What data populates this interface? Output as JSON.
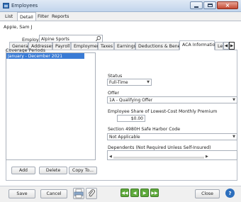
{
  "window": {
    "title": "Employees"
  },
  "menu": {
    "list": "List",
    "detail": "Detail",
    "filter": "Filter",
    "reports": "Reports"
  },
  "person": {
    "name": "Apple, Sam J"
  },
  "tabs": [
    "General",
    "Addresses",
    "Payroll",
    "Employment",
    "Taxes",
    "Earnings",
    "Deductions & Benefits",
    "ACA Information",
    "Le"
  ],
  "employer": {
    "label": "Employer",
    "value": "Alpine Sports"
  },
  "coverage": {
    "label": "Coverage Periods",
    "items": [
      "January - December 2021"
    ]
  },
  "status": {
    "label": "Status",
    "value": "Full-Time"
  },
  "offer": {
    "label": "Offer",
    "value": "1A - Qualifying Offer"
  },
  "premium": {
    "label": "Employee Share of Lowest-Cost Monthly Premium",
    "value": "$0.00"
  },
  "safe_harbor": {
    "label": "Section 4980H Safe Harbor Code",
    "value": "Not Applicable"
  },
  "dependents": {
    "label": "Dependents (Not Required Unless Self-Insured)"
  },
  "list_buttons": {
    "add": "Add",
    "delete": "Delete",
    "copy": "Copy To..."
  },
  "footer": {
    "save": "Save",
    "cancel": "Cancel",
    "close": "Close",
    "help": "?"
  },
  "colors": {
    "accent": "#3a7bd5",
    "nav": "#5faa3c",
    "title_bar": "#c2d5ec"
  },
  "icons": [
    "app-icon",
    "search-icon",
    "print-icon",
    "paperclip-icon",
    "nav-first-icon",
    "nav-prev-icon",
    "nav-next-icon",
    "nav-last-icon",
    "help-icon"
  ]
}
